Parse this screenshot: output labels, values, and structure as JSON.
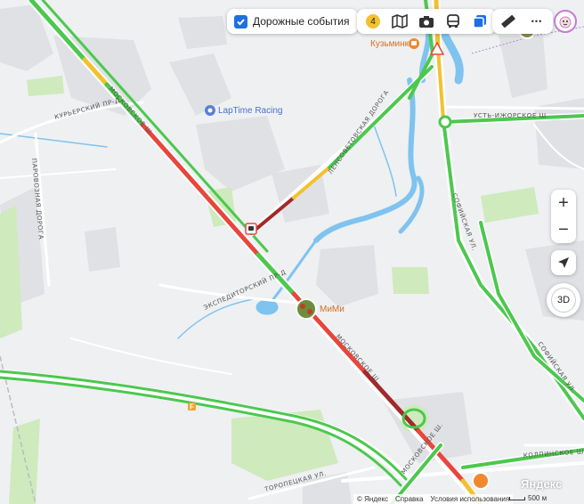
{
  "controls": {
    "road_events_label": "Дорожные события",
    "traffic_score": "4",
    "zoom_in": "+",
    "zoom_out": "−",
    "view_3d": "3D",
    "menu_glyph": "•••"
  },
  "map": {
    "roads": {
      "moskovskoe_upper": "МОСКОВСКОЕ Ш.",
      "moskovskoe_lower": "МОСКОВСКОЕ Ш.",
      "kurersky": "КУРЬЕРСКИЙ ПР-Д",
      "parovoznaya": "ПАРОВОЗНАЯ ДОРОГА",
      "lensovetovskaya": "ЛЕНСОВЕТОВСКАЯ ДОРОГА",
      "ust_izhorskoe": "УСТЬ-ИЖОРСКОЕ Ш.",
      "sofiyskaya_1": "СОФИЙСКАЯ УЛ.",
      "sofiyskaya_2": "СОФИЙСКАЯ УЛ.",
      "ekspeditorsky": "ЭКСПЕДИТОРСКИЙ ПР-Д",
      "kolpinskoe": "КОЛПИНСКОЕ Ш.",
      "toropetskaya": "ТОРОПЕЦКАЯ УЛ.",
      "moskovskoe_bottom": "МОСКОВСКОЕ Ш."
    },
    "pois": {
      "kuzminka": "Кузьминка",
      "laptime": "LapTime Racing",
      "mimi": "МиМи"
    },
    "route_shield": "F"
  },
  "attribution": {
    "copyright": "© Яндекс",
    "help": "Справка",
    "terms": "Условия использования",
    "scale": "500 м",
    "brand": "Яндекс"
  },
  "colors": {
    "green": "#4cc84e",
    "yellow": "#f2c12e",
    "red": "#e8463c",
    "dark_red": "#a12a2a",
    "water": "#7fc3ef",
    "park": "#cfeabd",
    "building": "#dfe1e4",
    "accent": "#1f6fe0"
  }
}
